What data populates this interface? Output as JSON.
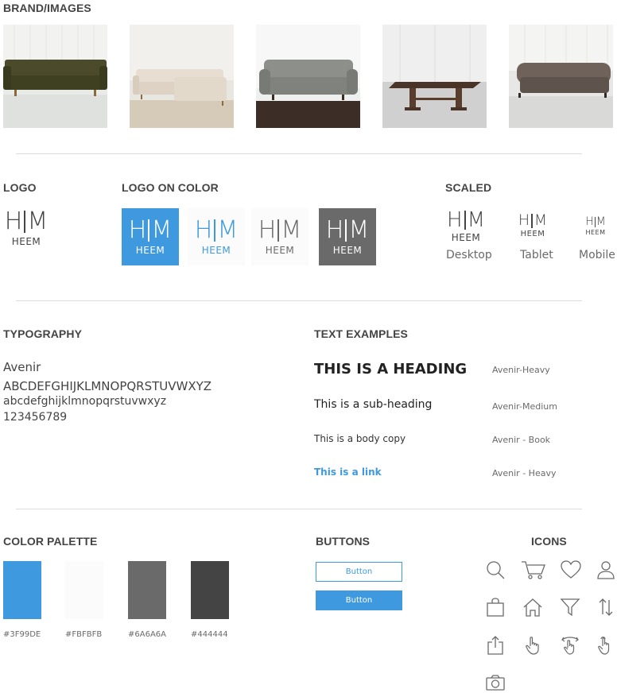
{
  "sections": {
    "brand_images": "BRAND/IMAGES",
    "logo": "LOGO",
    "logo_on_color": "LOGO ON COLOR",
    "scaled": "SCALED",
    "typography": "TYPOGRAPHY",
    "text_examples": "TEXT EXAMPLES",
    "color_palette": "COLOR PALETTE",
    "buttons": "BUTTONS",
    "icons": "ICONS"
  },
  "logo": {
    "letter_left": "H",
    "letter_right": "M",
    "word": "HEEM"
  },
  "logo_on_color_backgrounds": [
    "#3F99DE",
    "#FBFBFB",
    "#FBFBFB",
    "#6A6A6A"
  ],
  "scaled": {
    "desktop": "Desktop",
    "tablet": "Tablet",
    "mobile": "Mobile"
  },
  "typography": {
    "font_name": "Avenir",
    "uppercase": "ABCDEFGHIJKLMNOPQRSTUVWXYZ",
    "lowercase": "abcdefghijklmnopqrstuvwxyz",
    "digits": "123456789"
  },
  "text_examples": [
    {
      "text": "THIS IS A HEADING",
      "font": "Avenir-Heavy"
    },
    {
      "text": "This is a sub-heading",
      "font": "Avenir-Medium"
    },
    {
      "text": "This is a body copy",
      "font": "Avenir - Book"
    },
    {
      "text": "This is a link",
      "font": "Avenir - Heavy"
    }
  ],
  "palette": [
    {
      "hex": "#3F99DE",
      "color": "#3F99DE"
    },
    {
      "hex": "#FBFBFB",
      "color": "#FBFBFB"
    },
    {
      "hex": "#6A6A6A",
      "color": "#6A6A6A"
    },
    {
      "hex": "#444444",
      "color": "#444444"
    }
  ],
  "buttons": {
    "outline_label": "Button",
    "filled_label": "Button"
  },
  "icons": [
    "search-icon",
    "cart-icon",
    "heart-icon",
    "user-icon",
    "bag-icon",
    "home-icon",
    "filter-icon",
    "sort-icon",
    "share-icon",
    "tap-icon",
    "swipe-icon",
    "double-tap-icon",
    "camera-icon"
  ],
  "colors": {
    "accent": "#3F99DE",
    "text": "#444444",
    "muted": "#6A6A6A"
  }
}
